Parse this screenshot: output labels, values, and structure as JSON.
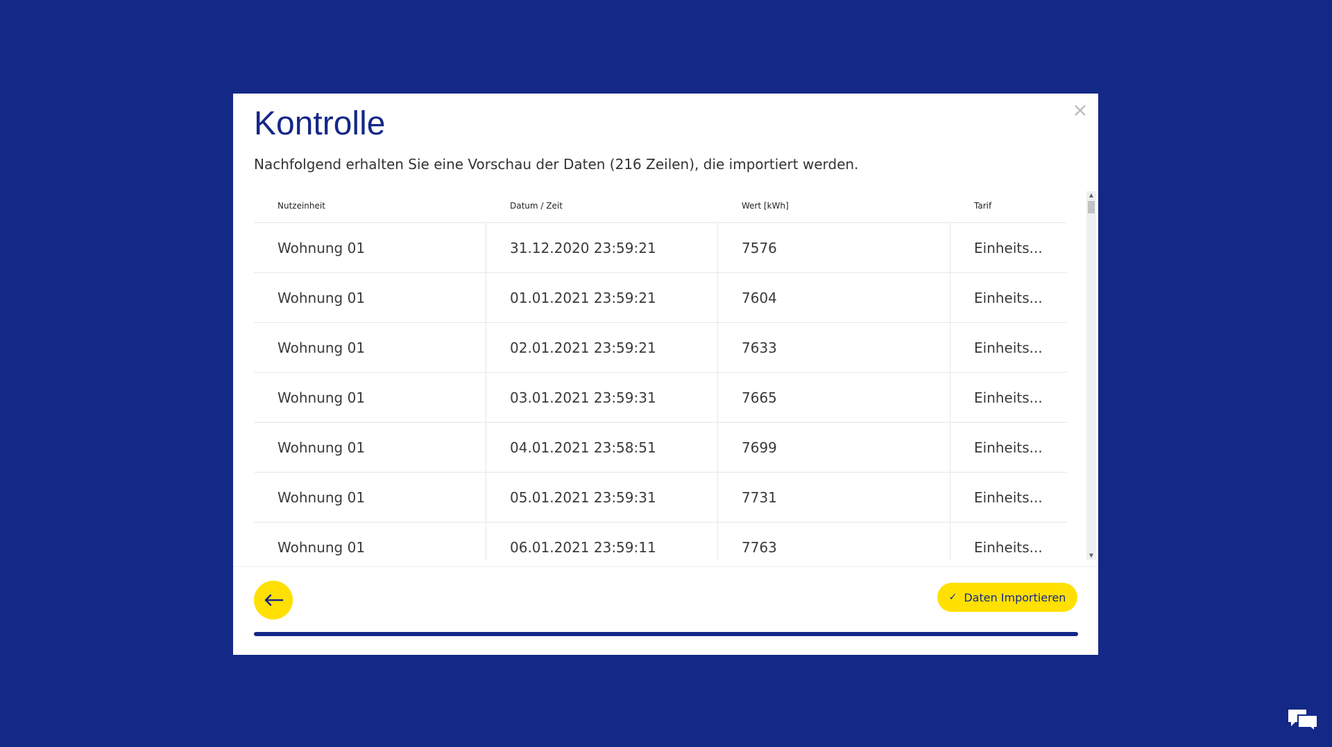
{
  "dialog": {
    "title": "Kontrolle",
    "subtitle": "Nachfolgend erhalten Sie eine Vorschau der Daten (216 Zeilen), die importiert werden.",
    "close_icon": "close-icon"
  },
  "table": {
    "headers": [
      "Nutzeinheit",
      "Datum / Zeit",
      "Wert [kWh]",
      "Tarif"
    ],
    "rows": [
      [
        "Wohnung 01",
        "31.12.2020 23:59:21",
        "7576",
        "Einheits..."
      ],
      [
        "Wohnung 01",
        "01.01.2021 23:59:21",
        "7604",
        "Einheits..."
      ],
      [
        "Wohnung 01",
        "02.01.2021 23:59:21",
        "7633",
        "Einheits..."
      ],
      [
        "Wohnung 01",
        "03.01.2021 23:59:31",
        "7665",
        "Einheits..."
      ],
      [
        "Wohnung 01",
        "04.01.2021 23:58:51",
        "7699",
        "Einheits..."
      ],
      [
        "Wohnung 01",
        "05.01.2021 23:59:31",
        "7731",
        "Einheits..."
      ],
      [
        "Wohnung 01",
        "06.01.2021 23:59:11",
        "7763",
        "Einheits..."
      ]
    ]
  },
  "footer": {
    "back_icon": "arrow-left-icon",
    "import_label": "Daten Importieren",
    "import_icon": "check-icon",
    "progress_percent": 100
  },
  "colors": {
    "background": "#142887",
    "accent": "#ffe000",
    "primary": "#142887"
  },
  "chat_icon": "chat-icon"
}
